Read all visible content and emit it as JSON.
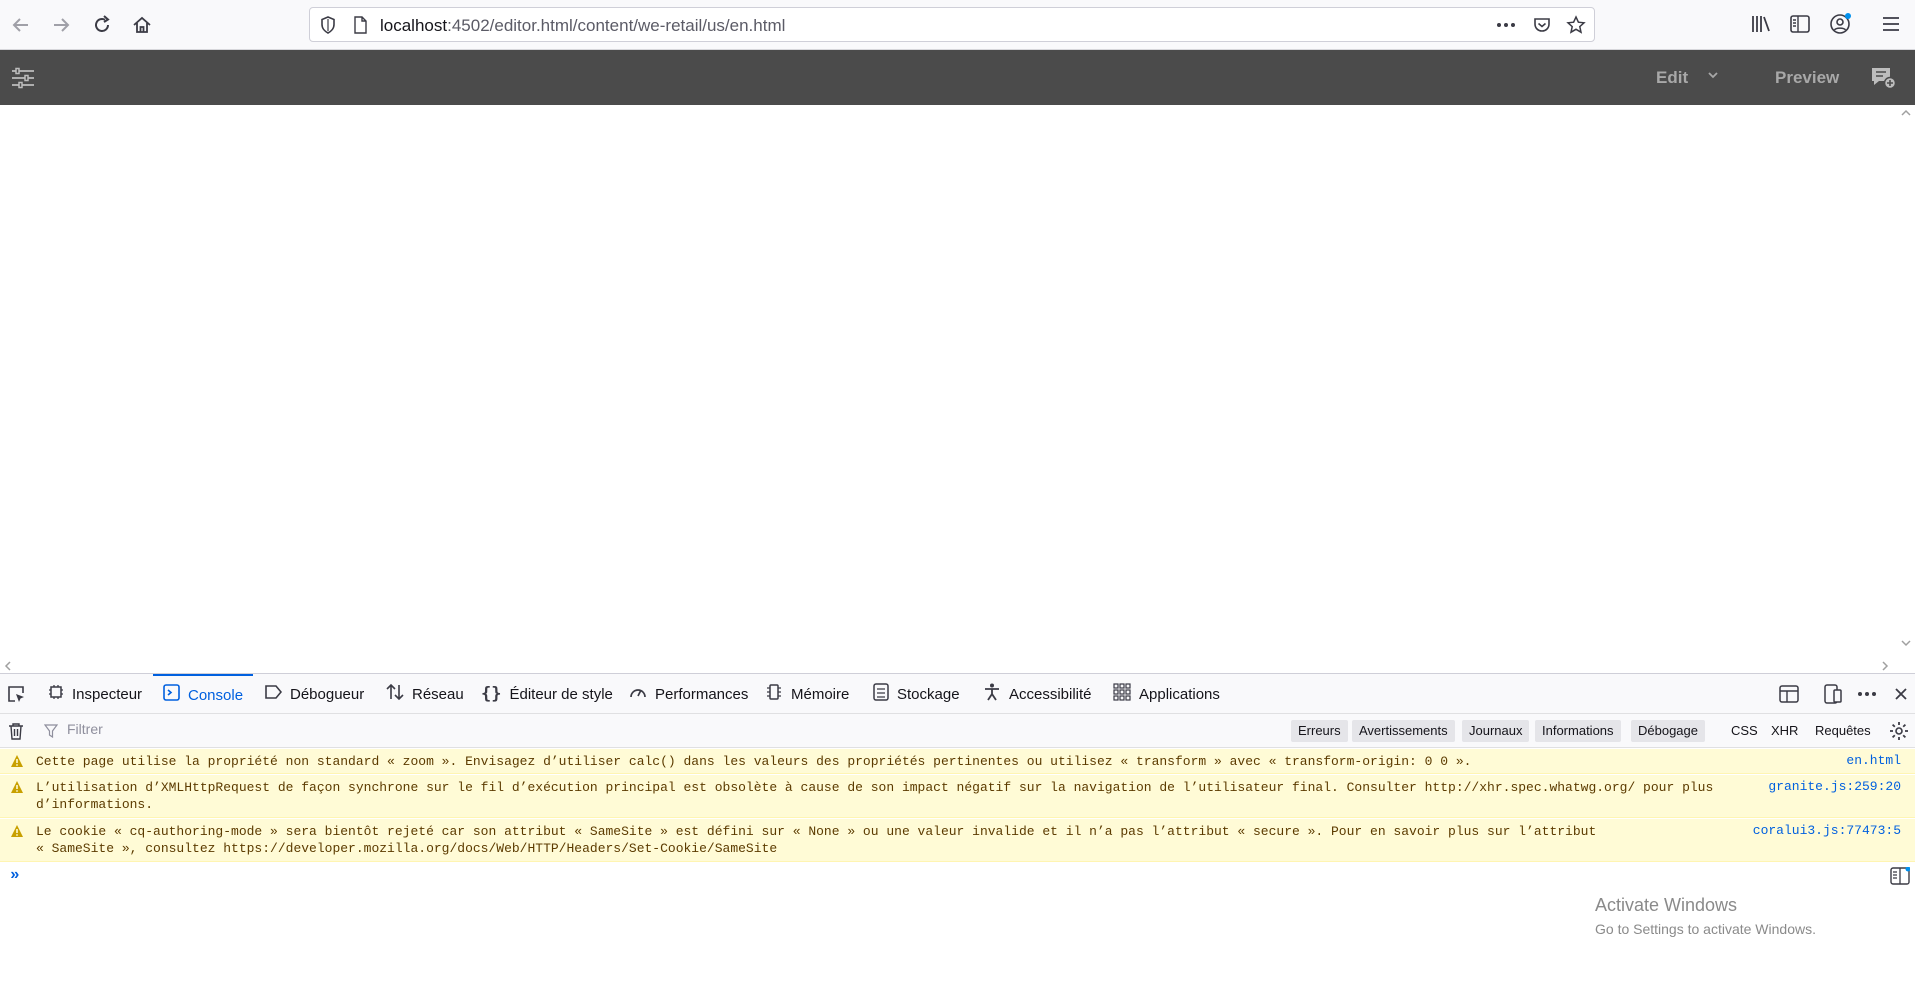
{
  "browser": {
    "url_host": "localhost",
    "url_path": ":4502/editor.html/content/we-retail/us/en.html",
    "icons": [
      "back-icon",
      "forward-icon",
      "reload-icon",
      "home-icon",
      "shield-icon",
      "page-icon",
      "more-icon",
      "pocket-icon",
      "bookmark-star-icon",
      "library-icon",
      "sidebar-icon",
      "account-icon",
      "menu-icon"
    ]
  },
  "editor_toolbar": {
    "edit_label": "Edit",
    "preview_label": "Preview"
  },
  "devtools": {
    "tabs": [
      {
        "label": "Inspecteur"
      },
      {
        "label": "Console"
      },
      {
        "label": "Débogueur"
      },
      {
        "label": "Réseau"
      },
      {
        "label": "Éditeur de style"
      },
      {
        "label": "Performances"
      },
      {
        "label": "Mémoire"
      },
      {
        "label": "Stockage"
      },
      {
        "label": "Accessibilité"
      },
      {
        "label": "Applications"
      }
    ],
    "active_tab": "Console",
    "filter_placeholder": "Filtrer",
    "filter_buttons": [
      "Erreurs",
      "Avertissements",
      "Journaux",
      "Informations",
      "Débogage"
    ],
    "filter_plain": [
      "CSS",
      "XHR",
      "Requêtes"
    ],
    "messages": [
      {
        "line1": "Cette page utilise la propriété non standard « zoom ». Envisagez d’utiliser calc() dans les valeurs des propriétés pertinentes ou utilisez « transform » avec « transform-origin: 0 0 ».",
        "line2": "",
        "source": "en.html"
      },
      {
        "line1": "L’utilisation d’XMLHttpRequest de façon synchrone sur le fil d’exécution principal est obsolète à cause de son impact négatif sur la navigation de l’utilisateur final. Consulter http://xhr.spec.whatwg.org/ pour plus",
        "line2": "d’informations.",
        "source": "granite.js:259:20"
      },
      {
        "line1": "Le cookie « cq-authoring-mode » sera bientôt rejeté car son attribut « SameSite » est défini sur « None » ou une valeur invalide et il n’a pas l’attribut « secure ». Pour en savoir plus sur l’attribut",
        "line2": "« SameSite », consultez https://developer.mozilla.org/docs/Web/HTTP/Headers/Set-Cookie/SameSite",
        "source": "coralui3.js:77473:5"
      }
    ],
    "prompt": "»"
  },
  "watermark": {
    "title": "Activate Windows",
    "subtitle": "Go to Settings to activate Windows."
  },
  "colors": {
    "toolbar_bg": "#4b4b4b",
    "active_tab": "#0060df",
    "warning_bg": "#fffbd6",
    "warning_icon": "#c8a000"
  }
}
